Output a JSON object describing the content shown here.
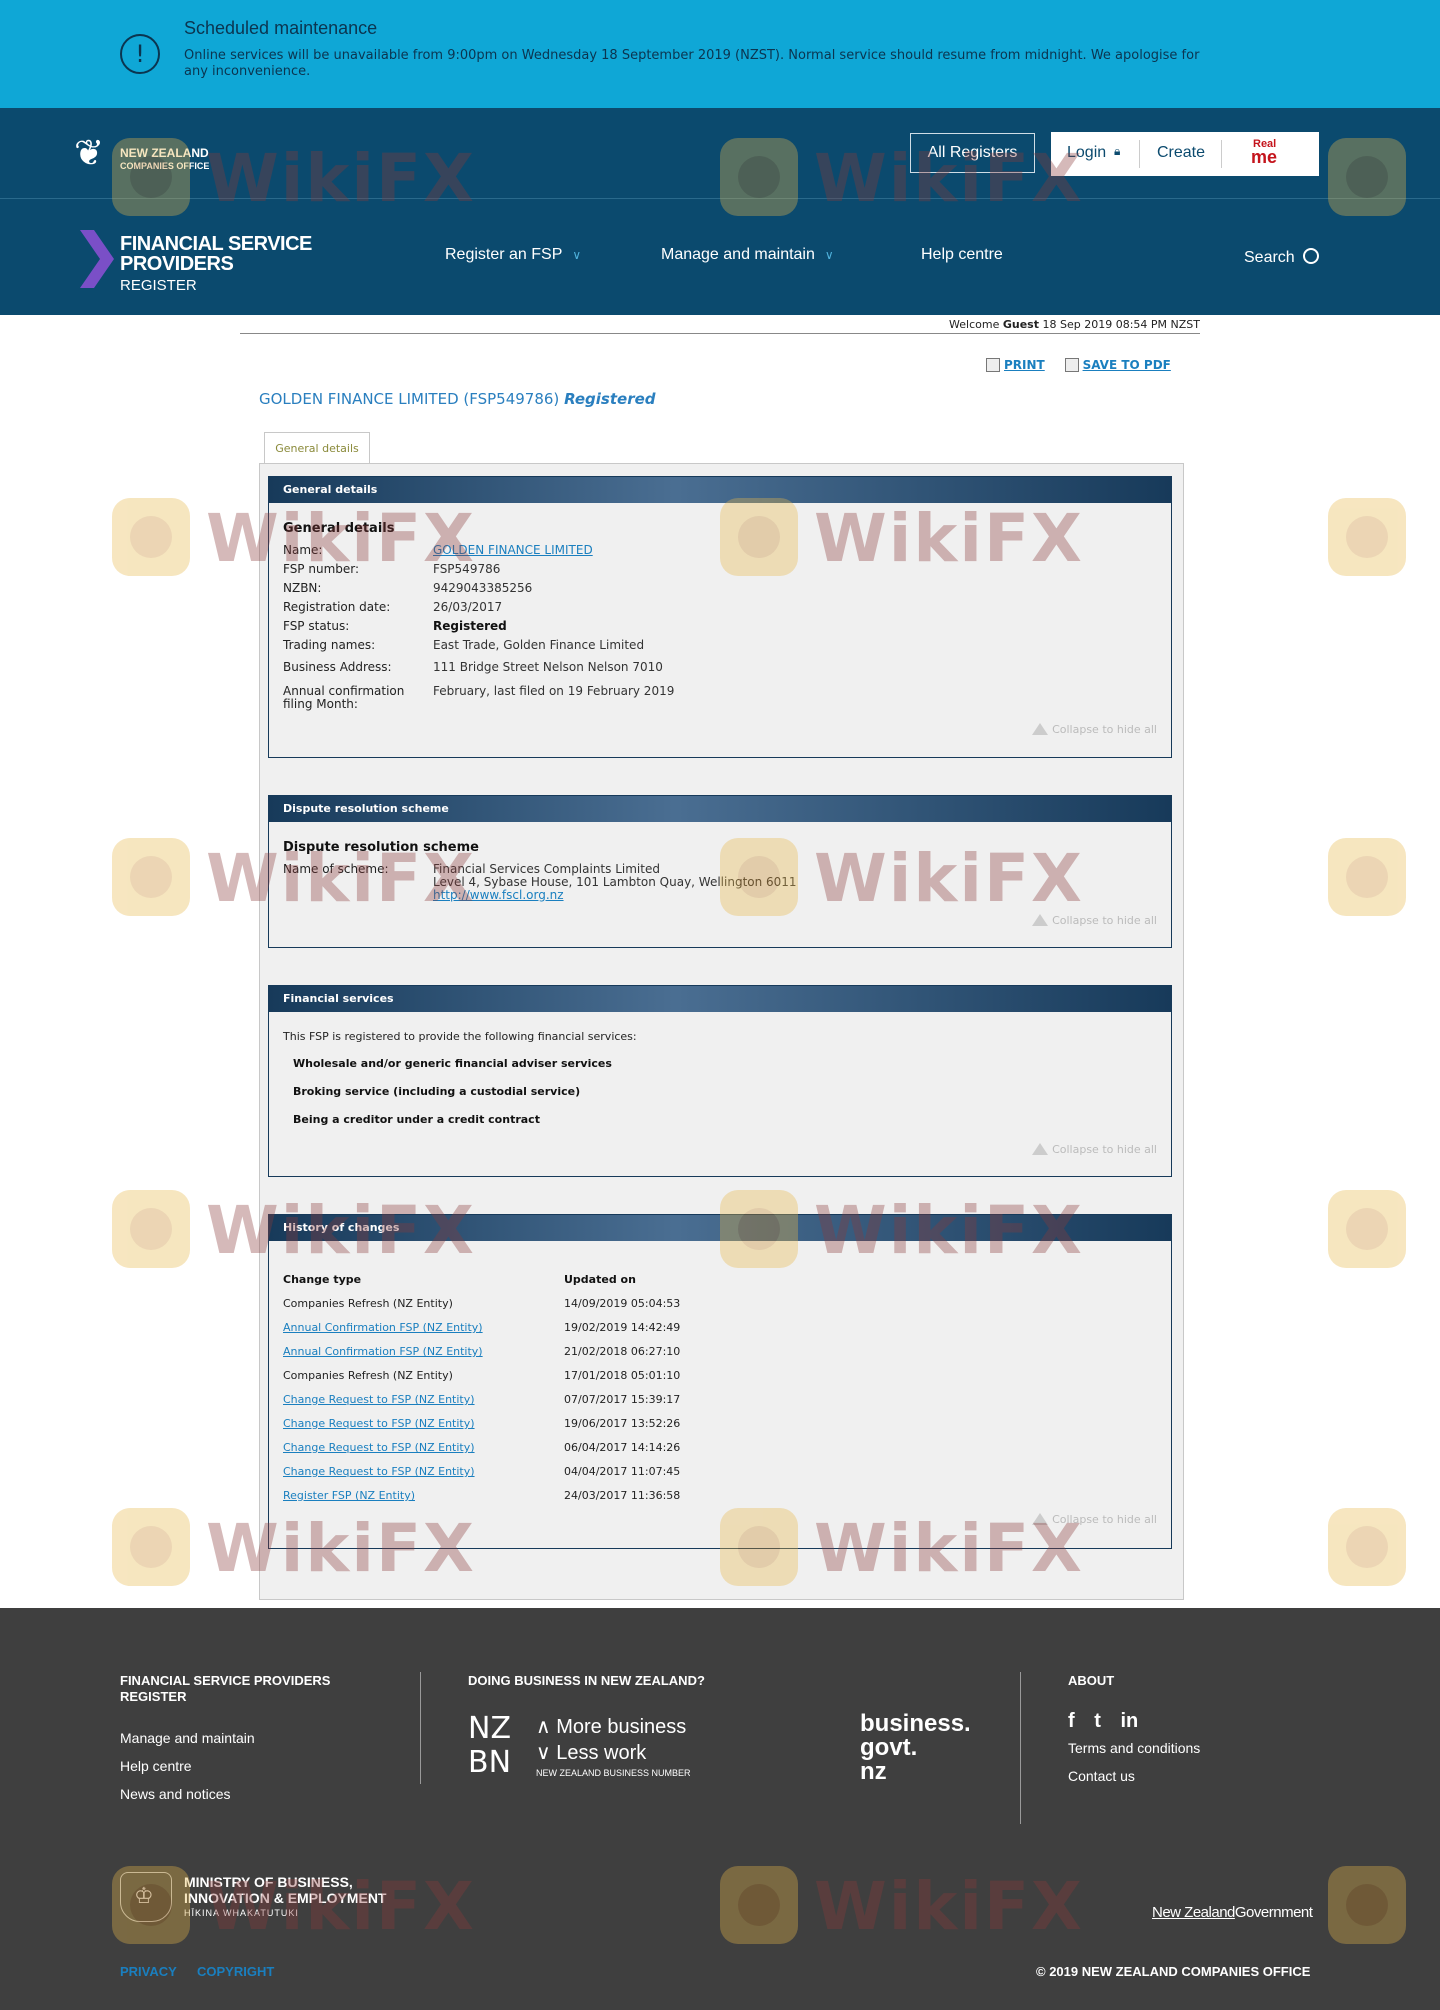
{
  "banner": {
    "title": "Scheduled maintenance",
    "message": "Online services will be unavailable from 9:00pm on Wednesday 18 September 2019 (NZST). Normal service should resume from midnight. We apologise for any inconvenience.",
    "icon": "alert-circle-icon"
  },
  "header": {
    "org_line1": "NEW ZEALAND",
    "org_line2": "COMPANIES OFFICE",
    "all_registers": "All Registers",
    "login": "Login",
    "create": "Create",
    "realme_1": "Real",
    "realme_2": "me",
    "fsp_line1": "FINANCIAL SERVICE",
    "fsp_line2": "PROVIDERS",
    "fsp_line3": "REGISTER",
    "nav": [
      "Register an FSP",
      "Manage and maintain",
      "Help centre"
    ],
    "search": "Search",
    "bg_color": "#0b4a6e",
    "banner_color": "#0fa7d6"
  },
  "welcome": {
    "prefix": "Welcome",
    "user": "Guest",
    "datetime": "18 Sep 2019 08:54 PM NZST"
  },
  "actions": {
    "print": "PRINT",
    "save_pdf": "SAVE TO PDF"
  },
  "entity": {
    "name": "GOLDEN FINANCE LIMITED (FSP549786)",
    "status": "Registered"
  },
  "tab": "General details",
  "collapse_label": "Collapse to hide all",
  "general": {
    "header": "General details",
    "subheading": "General details",
    "rows": [
      {
        "label": "Name:",
        "value": "GOLDEN FINANCE LIMITED"
      },
      {
        "label": "FSP number:",
        "value": "FSP549786"
      },
      {
        "label": "NZBN:",
        "value": "9429043385256"
      },
      {
        "label": "Registration date:",
        "value": "26/03/2017"
      },
      {
        "label": "FSP status:",
        "value": "Registered"
      },
      {
        "label": "Trading names:",
        "value": "East Trade, Golden Finance Limited"
      },
      {
        "label": "Business Address:",
        "value": "111 Bridge Street Nelson Nelson 7010"
      },
      {
        "label": "Annual confirmation filing Month:",
        "value": "February, last filed on 19 February 2019"
      }
    ]
  },
  "dispute": {
    "header": "Dispute resolution scheme",
    "subheading": "Dispute resolution scheme",
    "label": "Name of scheme:",
    "line1": "Financial Services Complaints Limited",
    "line2": "Level 4, Sybase House, 101 Lambton Quay, Wellington 6011",
    "link": "http://www.fscl.org.nz"
  },
  "services": {
    "header": "Financial services",
    "intro": "This FSP is registered to provide the following financial services:",
    "items": [
      "Wholesale and/or generic financial adviser services",
      "Broking service (including a custodial service)",
      "Being a creditor under a credit contract"
    ]
  },
  "history": {
    "header": "History of changes",
    "col1": "Change type",
    "col2": "Updated on",
    "rows": [
      {
        "type": "Companies Refresh (NZ Entity)",
        "date": "14/09/2019 05:04:53",
        "link": false
      },
      {
        "type": "Annual Confirmation FSP (NZ Entity)",
        "date": "19/02/2019 14:42:49",
        "link": true
      },
      {
        "type": "Annual Confirmation FSP (NZ Entity)",
        "date": "21/02/2018 06:27:10",
        "link": true
      },
      {
        "type": "Companies Refresh (NZ Entity)",
        "date": "17/01/2018 05:01:10",
        "link": false
      },
      {
        "type": "Change Request to FSP (NZ Entity)",
        "date": "07/07/2017 15:39:17",
        "link": true
      },
      {
        "type": "Change Request to FSP (NZ Entity)",
        "date": "19/06/2017 13:52:26",
        "link": true
      },
      {
        "type": "Change Request to FSP (NZ Entity)",
        "date": "06/04/2017 14:14:26",
        "link": true
      },
      {
        "type": "Change Request to FSP (NZ Entity)",
        "date": "04/04/2017 11:07:45",
        "link": true
      },
      {
        "type": "Register FSP (NZ Entity)",
        "date": "24/03/2017 11:36:58",
        "link": true
      }
    ]
  },
  "footer": {
    "col1_heading": "FINANCIAL SERVICE PROVIDERS REGISTER",
    "col1_links": [
      "Manage and maintain",
      "Help centre",
      "News and notices"
    ],
    "col2_heading": "DOING BUSINESS IN NEW ZEALAND?",
    "nzbn_1": "NZ",
    "nzbn_2": "BN",
    "nzbn_more": "More business",
    "nzbn_less": "Less work",
    "nzbn_caption": "NEW ZEALAND BUSINESS NUMBER",
    "bizgov_1": "business.",
    "bizgov_2": "govt.",
    "bizgov_3": "nz",
    "col3_heading": "ABOUT",
    "social": [
      "f",
      "t",
      "in"
    ],
    "about_links": [
      "Terms and conditions",
      "Contact us"
    ],
    "mbie_1": "MINISTRY OF BUSINESS,",
    "mbie_2": "INNOVATION & EMPLOYMENT",
    "mbie_3": "HĪKINA WHAKATUTUKI",
    "nzgov_1": "New Zealand",
    "nzgov_2": "Government",
    "privacy": "PRIVACY",
    "copyright": "COPYRIGHT",
    "copy_notice": "© 2019 NEW ZEALAND COMPANIES OFFICE"
  },
  "watermark": "WikiFX"
}
